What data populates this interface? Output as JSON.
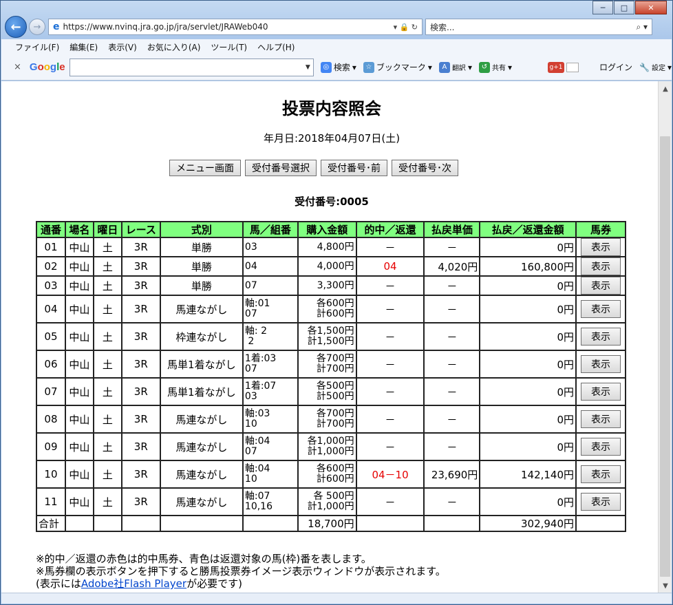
{
  "browser": {
    "url": "https://www.nvinq.jra.go.jp/jra/servlet/JRAWeb040",
    "search_placeholder": "検索...",
    "menu": [
      "ファイル(F)",
      "編集(E)",
      "表示(V)",
      "お気に入り(A)",
      "ツール(T)",
      "ヘルプ(H)"
    ],
    "google_toolbar": {
      "logo": "Google",
      "search_label": "検索",
      "bookmark_label": "ブックマーク",
      "translate_label": "翻訳",
      "share_label": "共有",
      "gplus_label": "+1",
      "login_label": "ログイン",
      "settings_label": "設定"
    }
  },
  "page": {
    "title": "投票内容照会",
    "date_line": "年月日:2018年04月07日(土)",
    "buttons": {
      "menu": "メニュー画面",
      "select": "受付番号選択",
      "prev": "受付番号･前",
      "next": "受付番号･次"
    },
    "receipt_line": "受付番号:0005",
    "headers": [
      "通番",
      "場名",
      "曜日",
      "レース",
      "式別",
      "馬／組番",
      "購入金額",
      "的中／返還",
      "払戻単価",
      "払戻／返還金額",
      "馬券"
    ],
    "show_label": "表示",
    "rows": [
      {
        "no": "01",
        "place": "中山",
        "day": "土",
        "race": "3R",
        "type": "単勝",
        "combo1": "03",
        "combo2": "",
        "amt1": "4,800円",
        "amt2": "",
        "hit": "－",
        "unit": "－",
        "payout": "0円",
        "hit_red": false
      },
      {
        "no": "02",
        "place": "中山",
        "day": "土",
        "race": "3R",
        "type": "単勝",
        "combo1": "04",
        "combo2": "",
        "amt1": "4,000円",
        "amt2": "",
        "hit": "04",
        "unit": "4,020円",
        "payout": "160,800円",
        "hit_red": true
      },
      {
        "no": "03",
        "place": "中山",
        "day": "土",
        "race": "3R",
        "type": "単勝",
        "combo1": "07",
        "combo2": "",
        "amt1": "3,300円",
        "amt2": "",
        "hit": "－",
        "unit": "－",
        "payout": "0円",
        "hit_red": false
      },
      {
        "no": "04",
        "place": "中山",
        "day": "土",
        "race": "3R",
        "type": "馬連ながし",
        "combo1": "軸:01",
        "combo2": "07",
        "amt1": "各600円",
        "amt2": "計600円",
        "hit": "－",
        "unit": "－",
        "payout": "0円",
        "hit_red": false
      },
      {
        "no": "05",
        "place": "中山",
        "day": "土",
        "race": "3R",
        "type": "枠連ながし",
        "combo1": "軸: 2",
        "combo2": " 2",
        "amt1": "各1,500円",
        "amt2": "計1,500円",
        "hit": "－",
        "unit": "－",
        "payout": "0円",
        "hit_red": false
      },
      {
        "no": "06",
        "place": "中山",
        "day": "土",
        "race": "3R",
        "type": "馬単1着ながし",
        "combo1": "1着:03",
        "combo2": "07",
        "amt1": "各700円",
        "amt2": "計700円",
        "hit": "－",
        "unit": "－",
        "payout": "0円",
        "hit_red": false
      },
      {
        "no": "07",
        "place": "中山",
        "day": "土",
        "race": "3R",
        "type": "馬単1着ながし",
        "combo1": "1着:07",
        "combo2": "03",
        "amt1": "各500円",
        "amt2": "計500円",
        "hit": "－",
        "unit": "－",
        "payout": "0円",
        "hit_red": false
      },
      {
        "no": "08",
        "place": "中山",
        "day": "土",
        "race": "3R",
        "type": "馬連ながし",
        "combo1": "軸:03",
        "combo2": "10",
        "amt1": "各700円",
        "amt2": "計700円",
        "hit": "－",
        "unit": "－",
        "payout": "0円",
        "hit_red": false
      },
      {
        "no": "09",
        "place": "中山",
        "day": "土",
        "race": "3R",
        "type": "馬連ながし",
        "combo1": "軸:04",
        "combo2": "07",
        "amt1": "各1,000円",
        "amt2": "計1,000円",
        "hit": "－",
        "unit": "－",
        "payout": "0円",
        "hit_red": false
      },
      {
        "no": "10",
        "place": "中山",
        "day": "土",
        "race": "3R",
        "type": "馬連ながし",
        "combo1": "軸:04",
        "combo2": "10",
        "amt1": "各600円",
        "amt2": "計600円",
        "hit": "04－10",
        "unit": "23,690円",
        "payout": "142,140円",
        "hit_red": true
      },
      {
        "no": "11",
        "place": "中山",
        "day": "土",
        "race": "3R",
        "type": "馬連ながし",
        "combo1": "軸:07",
        "combo2": "10,16",
        "amt1": "各 500円",
        "amt2": "計1,000円",
        "hit": "－",
        "unit": "－",
        "payout": "0円",
        "hit_red": false
      }
    ],
    "total": {
      "label": "合計",
      "amount": "18,700円",
      "payout": "302,940円"
    },
    "notes": {
      "line1": "※的中／返還の赤色は的中馬券、青色は返還対象の馬(枠)番を表します。",
      "line2": "※馬券欄の表示ボタンを押下すると勝馬投票券イメージ表示ウィンドウが表示されます。",
      "line3_pre": "(表示には",
      "line3_link": "Adobe社Flash Player",
      "line3_post": "が必要です)"
    },
    "colors": {
      "header_bg": "#80ff80",
      "hit_red": "#e60000",
      "link": "#0044cc"
    }
  }
}
